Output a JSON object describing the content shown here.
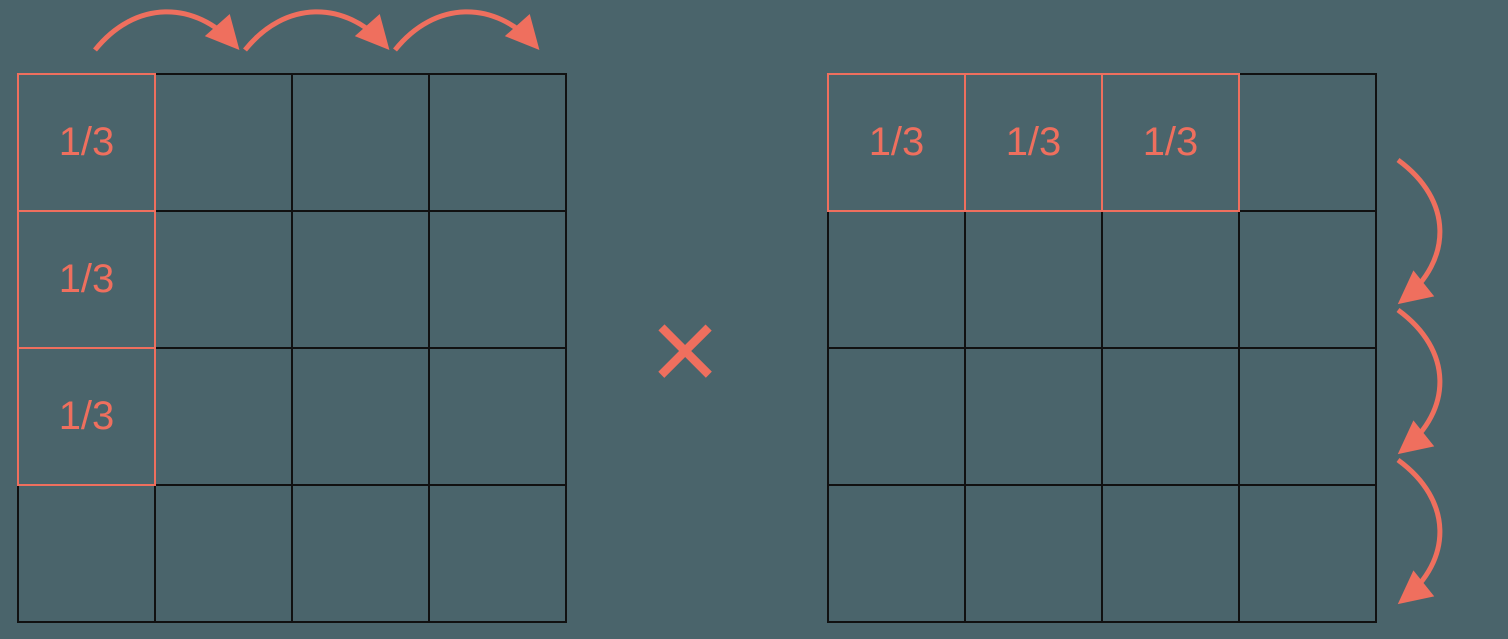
{
  "diagram": {
    "accent_color": "#ef6f5e",
    "border_color": "#111111",
    "bg_color": "#4a646b",
    "operator": "×",
    "left_matrix": {
      "rows": 4,
      "cols": 4,
      "highlight": "first-column-top3",
      "cells": [
        "1/3",
        "1/3",
        "1/3"
      ]
    },
    "right_matrix": {
      "rows": 4,
      "cols": 4,
      "highlight": "first-row-left3",
      "cells": [
        "1/3",
        "1/3",
        "1/3"
      ]
    },
    "arrows": {
      "top": "three curved arrows sweeping right over left matrix columns",
      "right": "three curved arrows sweeping down beside right matrix rows"
    }
  }
}
